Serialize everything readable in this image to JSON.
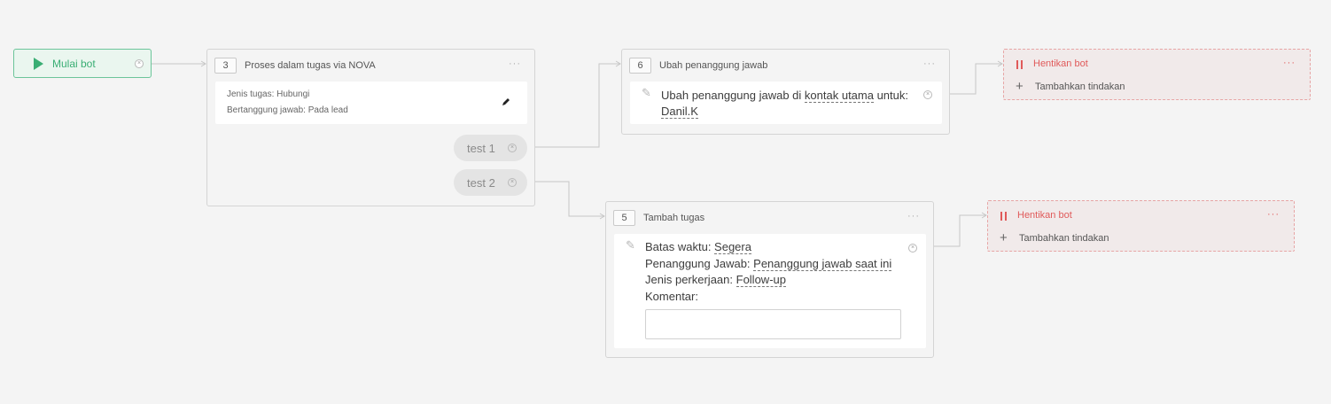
{
  "start": {
    "label": "Mulai bot"
  },
  "node3": {
    "number": "3",
    "title": "Proses dalam tugas via NOVA",
    "menu": "···",
    "task_type": "Jenis tugas: Hubungi",
    "responsible": "Bertanggung jawab: Pada lead",
    "edit_icon": "pencil-icon",
    "branches": [
      "test 1",
      "test 2"
    ]
  },
  "node6": {
    "number": "6",
    "title": "Ubah penanggung jawab",
    "menu": "···",
    "text_a": "Ubah penanggung jawab di ",
    "link_a": "kontak utama",
    "text_b": " untuk:",
    "link_b": "Danil.K"
  },
  "node5": {
    "number": "5",
    "title": "Tambah tugas",
    "menu": "···",
    "deadline_label": "Batas waktu: ",
    "deadline_value": "Segera",
    "assignee_label": "Penanggung Jawab: ",
    "assignee_value": "Penanggung jawab saat ini",
    "work_label": "Jenis perkerjaan: ",
    "work_value": "Follow-up",
    "comment_label": "Komentar:",
    "comment_value": ""
  },
  "stop_top": {
    "label": "Hentikan bot",
    "add_label": "Tambahkan tindakan",
    "menu": "···"
  },
  "stop_bottom": {
    "label": "Hentikan bot",
    "add_label": "Tambahkan tindakan",
    "menu": "···"
  },
  "colors": {
    "start": "#3aae74",
    "stop": "#e05a5a",
    "border": "#d4d4d4"
  }
}
